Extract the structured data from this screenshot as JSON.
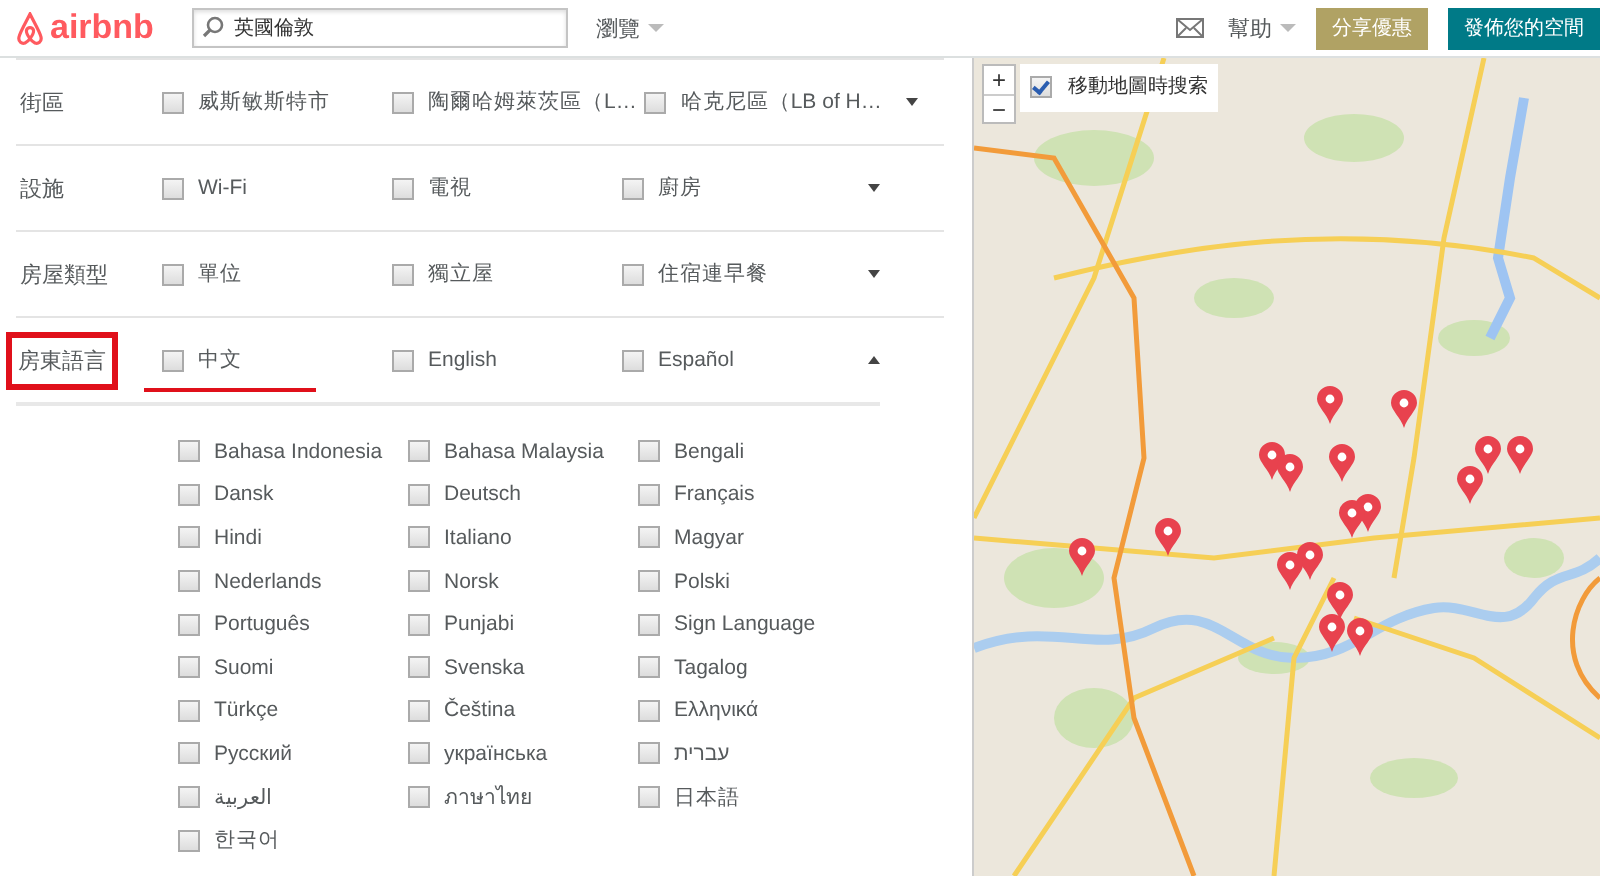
{
  "header": {
    "logo": "airbnb",
    "search": {
      "value": "英國倫敦"
    },
    "browse": "瀏覽",
    "help": "幫助",
    "share_button": "分享優惠",
    "host_button": "發佈您的空間"
  },
  "filters": [
    {
      "label": "街區",
      "highlighted": false,
      "expanded": false,
      "options": [
        {
          "label": "威斯敏斯特市",
          "checked": false,
          "underlined": false
        },
        {
          "label": "陶爾哈姆萊茨區（L…",
          "checked": false,
          "underlined": false
        },
        {
          "label": "哈克尼區（LB of H…",
          "checked": false,
          "underlined": false
        }
      ]
    },
    {
      "label": "設施",
      "highlighted": false,
      "expanded": false,
      "options": [
        {
          "label": "Wi-Fi",
          "checked": false,
          "underlined": false
        },
        {
          "label": "電視",
          "checked": false,
          "underlined": false
        },
        {
          "label": "廚房",
          "checked": false,
          "underlined": false
        }
      ]
    },
    {
      "label": "房屋類型",
      "highlighted": false,
      "expanded": false,
      "options": [
        {
          "label": "單位",
          "checked": false,
          "underlined": false
        },
        {
          "label": "獨立屋",
          "checked": false,
          "underlined": false
        },
        {
          "label": "住宿連早餐",
          "checked": false,
          "underlined": false
        }
      ]
    },
    {
      "label": "房東語言",
      "highlighted": true,
      "expanded": true,
      "options": [
        {
          "label": "中文",
          "checked": false,
          "underlined": true
        },
        {
          "label": "English",
          "checked": false,
          "underlined": false
        },
        {
          "label": "Español",
          "checked": false,
          "underlined": false
        }
      ]
    }
  ],
  "languages": [
    {
      "label": "Bahasa Indonesia",
      "checked": false
    },
    {
      "label": "Bahasa Malaysia",
      "checked": false
    },
    {
      "label": "Bengali",
      "checked": false
    },
    {
      "label": "Dansk",
      "checked": false
    },
    {
      "label": "Deutsch",
      "checked": false
    },
    {
      "label": "Français",
      "checked": false
    },
    {
      "label": "Hindi",
      "checked": false
    },
    {
      "label": "Italiano",
      "checked": false
    },
    {
      "label": "Magyar",
      "checked": false
    },
    {
      "label": "Nederlands",
      "checked": false
    },
    {
      "label": "Norsk",
      "checked": false
    },
    {
      "label": "Polski",
      "checked": false
    },
    {
      "label": "Português",
      "checked": false
    },
    {
      "label": "Punjabi",
      "checked": false
    },
    {
      "label": "Sign Language",
      "checked": false
    },
    {
      "label": "Suomi",
      "checked": false
    },
    {
      "label": "Svenska",
      "checked": false
    },
    {
      "label": "Tagalog",
      "checked": false
    },
    {
      "label": "Türkçe",
      "checked": false
    },
    {
      "label": "Čeština",
      "checked": false
    },
    {
      "label": "Ελληνικά",
      "checked": false
    },
    {
      "label": "Русский",
      "checked": false
    },
    {
      "label": "українська",
      "checked": false
    },
    {
      "label": "עברית",
      "checked": false
    },
    {
      "label": "العربية",
      "checked": false
    },
    {
      "label": "ภาษาไทย",
      "checked": false
    },
    {
      "label": "日本語",
      "checked": false
    },
    {
      "label": "한국어",
      "checked": false
    }
  ],
  "map": {
    "zoom_in": "+",
    "zoom_out": "−",
    "search_toggle": {
      "label": "移動地圖時搜索",
      "checked": true
    }
  }
}
